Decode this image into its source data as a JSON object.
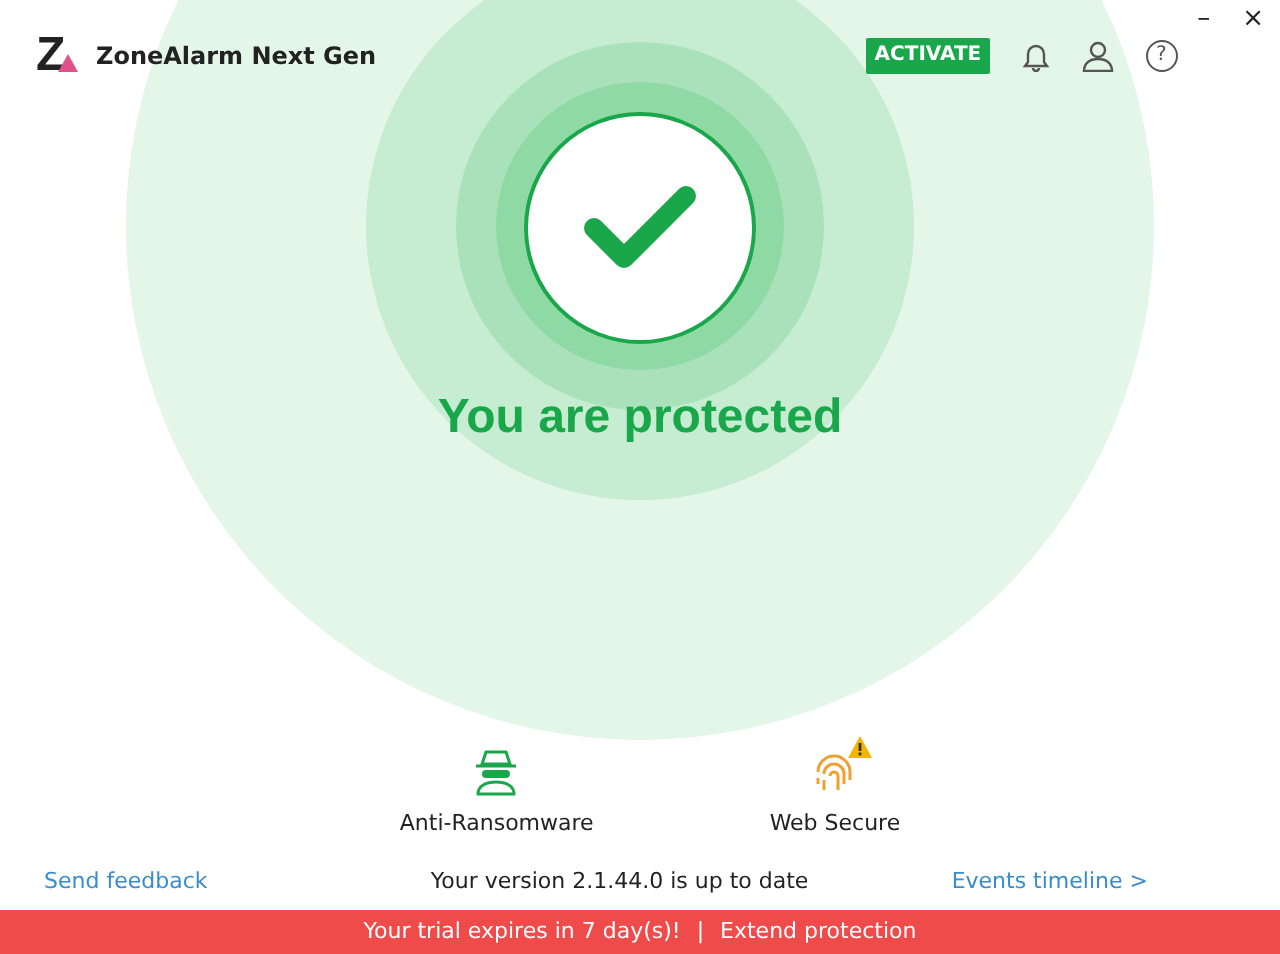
{
  "app": {
    "logo_mark": "Z",
    "title": "ZoneAlarm Next Gen"
  },
  "header": {
    "activate": "ACTIVATE",
    "help": "?"
  },
  "window_controls": {
    "minimize": "–",
    "close": "×"
  },
  "status": {
    "title": "You are protected"
  },
  "features": [
    {
      "kind": "mask",
      "label": "Anti-Ransomware",
      "warning": false
    },
    {
      "kind": "fingerprint",
      "label": "Web Secure",
      "warning": true
    }
  ],
  "footer": {
    "feedback": "Send feedback",
    "version": "Your version 2.1.44.0 is up to date",
    "timeline": "Events timeline >"
  },
  "trial_bar": {
    "message": "Your trial expires in 7 day(s)!",
    "separator": "|",
    "link": "Extend protection"
  }
}
